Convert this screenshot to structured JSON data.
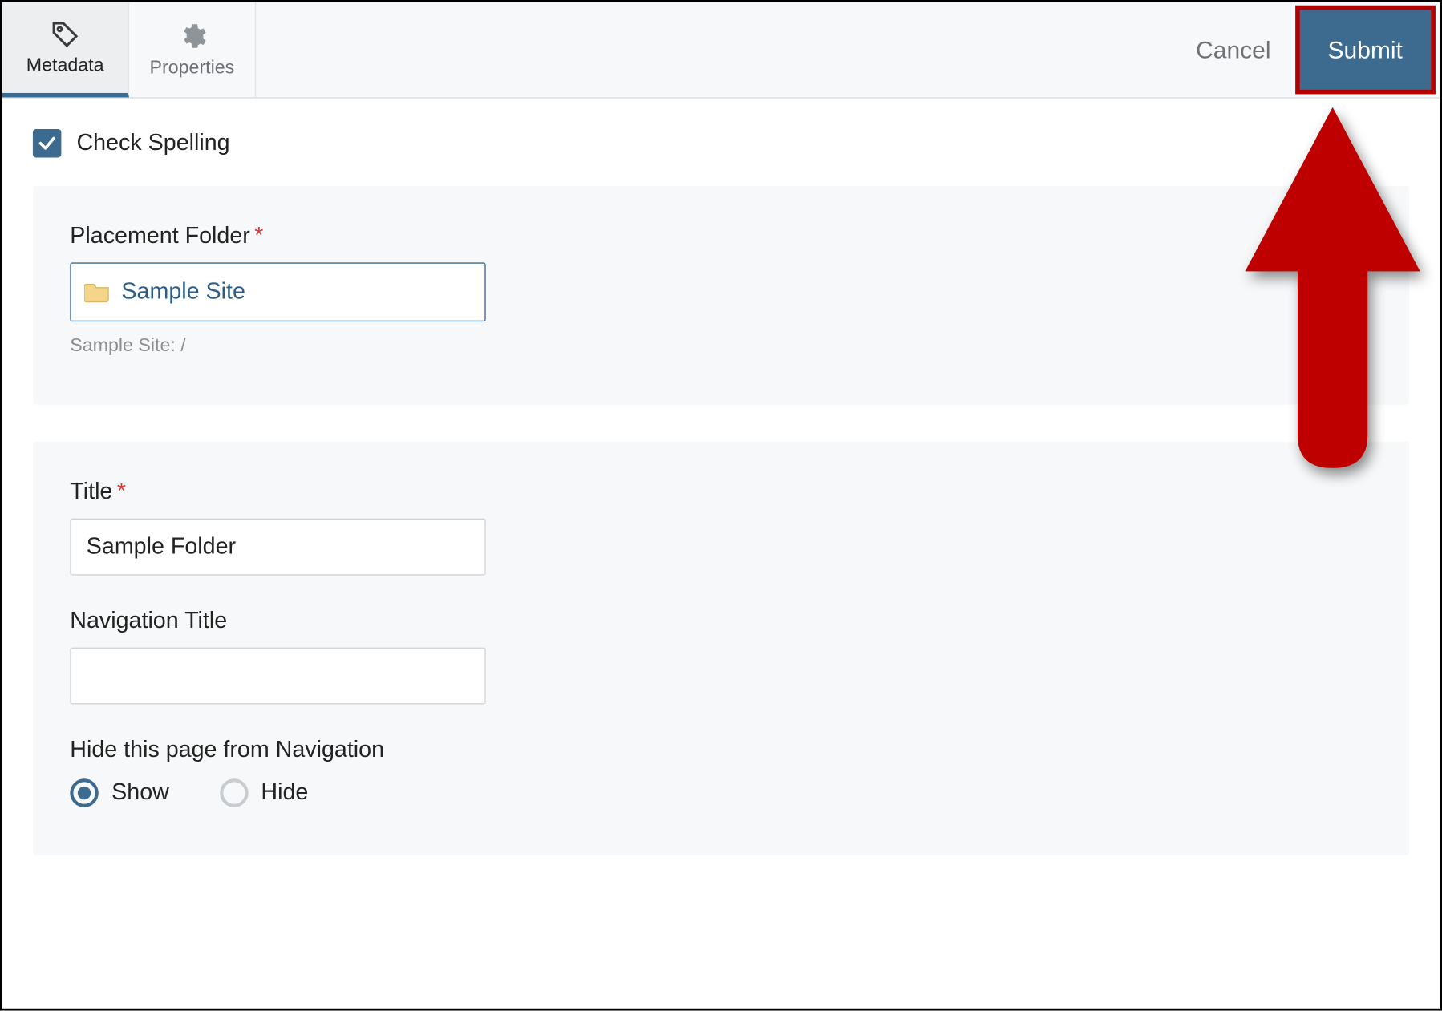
{
  "tabs": {
    "metadata": "Metadata",
    "properties": "Properties"
  },
  "actions": {
    "cancel": "Cancel",
    "submit": "Submit"
  },
  "check_spelling_label": "Check Spelling",
  "placement": {
    "label": "Placement Folder",
    "value": "Sample Site",
    "path": "Sample Site: /"
  },
  "title_field": {
    "label": "Title",
    "value": "Sample Folder"
  },
  "nav_title_field": {
    "label": "Navigation Title",
    "value": ""
  },
  "hide_nav": {
    "label": "Hide this page from Navigation",
    "show": "Show",
    "hide": "Hide"
  }
}
